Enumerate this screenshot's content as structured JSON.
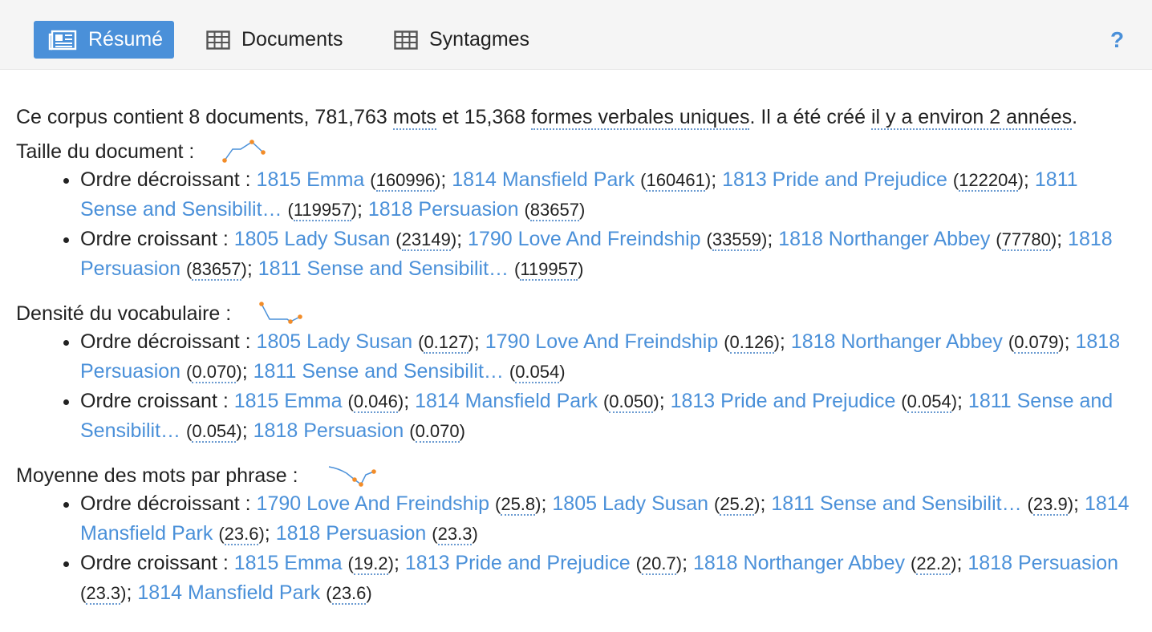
{
  "tabs": [
    {
      "label": "Résumé",
      "icon": "newspaper-icon",
      "active": true
    },
    {
      "label": "Documents",
      "icon": "table-icon",
      "active": false
    },
    {
      "label": "Syntagmes",
      "icon": "table-icon",
      "active": false
    }
  ],
  "help_label": "?",
  "accent_color": "#4a90d9",
  "summary": {
    "p1": "Ce corpus contient 8 documents, 781,763 ",
    "words_link": "mots",
    "p2": " et 15,368 ",
    "forms_link": "formes verbales uniques",
    "p3": ". Il a été créé ",
    "age_link": "il y a environ 2 années",
    "p4": "."
  },
  "sections": [
    {
      "title": "Taille du document :",
      "lists": [
        {
          "label": "Ordre décroissant :",
          "items": [
            {
              "name": "1815 Emma",
              "value": "160996"
            },
            {
              "name": "1814 Mansfield Park",
              "value": "160461"
            },
            {
              "name": "1813 Pride and Prejudice",
              "value": "122204"
            },
            {
              "name": "1811 Sense and Sensibilit…",
              "value": "119957"
            },
            {
              "name": "1818 Persuasion",
              "value": "83657"
            }
          ]
        },
        {
          "label": "Ordre croissant :",
          "items": [
            {
              "name": "1805 Lady Susan",
              "value": "23149"
            },
            {
              "name": "1790 Love And Freindship",
              "value": "33559"
            },
            {
              "name": "1818 Northanger Abbey",
              "value": "77780"
            },
            {
              "name": "1818 Persuasion",
              "value": "83657"
            },
            {
              "name": "1811 Sense and Sensibilit…",
              "value": "119957"
            }
          ]
        }
      ]
    },
    {
      "title": "Densité du vocabulaire :",
      "lists": [
        {
          "label": "Ordre décroissant :",
          "items": [
            {
              "name": "1805 Lady Susan",
              "value": "0.127"
            },
            {
              "name": "1790 Love And Freindship",
              "value": "0.126"
            },
            {
              "name": "1818 Northanger Abbey",
              "value": "0.079"
            },
            {
              "name": "1818 Persuasion",
              "value": "0.070"
            },
            {
              "name": "1811 Sense and Sensibilit…",
              "value": "0.054"
            }
          ]
        },
        {
          "label": "Ordre croissant :",
          "items": [
            {
              "name": "1815 Emma",
              "value": "0.046"
            },
            {
              "name": "1814 Mansfield Park",
              "value": "0.050"
            },
            {
              "name": "1813 Pride and Prejudice",
              "value": "0.054"
            },
            {
              "name": "1811 Sense and Sensibilit…",
              "value": "0.054"
            },
            {
              "name": "1818 Persuasion",
              "value": "0.070"
            }
          ]
        }
      ]
    },
    {
      "title": "Moyenne des mots par phrase :",
      "lists": [
        {
          "label": "Ordre décroissant :",
          "items": [
            {
              "name": "1790 Love And Freindship",
              "value": "25.8"
            },
            {
              "name": "1805 Lady Susan",
              "value": "25.2"
            },
            {
              "name": "1811 Sense and Sensibilit…",
              "value": "23.9"
            },
            {
              "name": "1814 Mansfield Park",
              "value": "23.6"
            },
            {
              "name": "1818 Persuasion",
              "value": "23.3"
            }
          ]
        },
        {
          "label": "Ordre croissant :",
          "items": [
            {
              "name": "1815 Emma",
              "value": "19.2"
            },
            {
              "name": "1813 Pride and Prejudice",
              "value": "20.7"
            },
            {
              "name": "1818 Northanger Abbey",
              "value": "22.2"
            },
            {
              "name": "1818 Persuasion",
              "value": "23.3"
            },
            {
              "name": "1814 Mansfield Park",
              "value": "23.6"
            }
          ]
        }
      ]
    }
  ]
}
